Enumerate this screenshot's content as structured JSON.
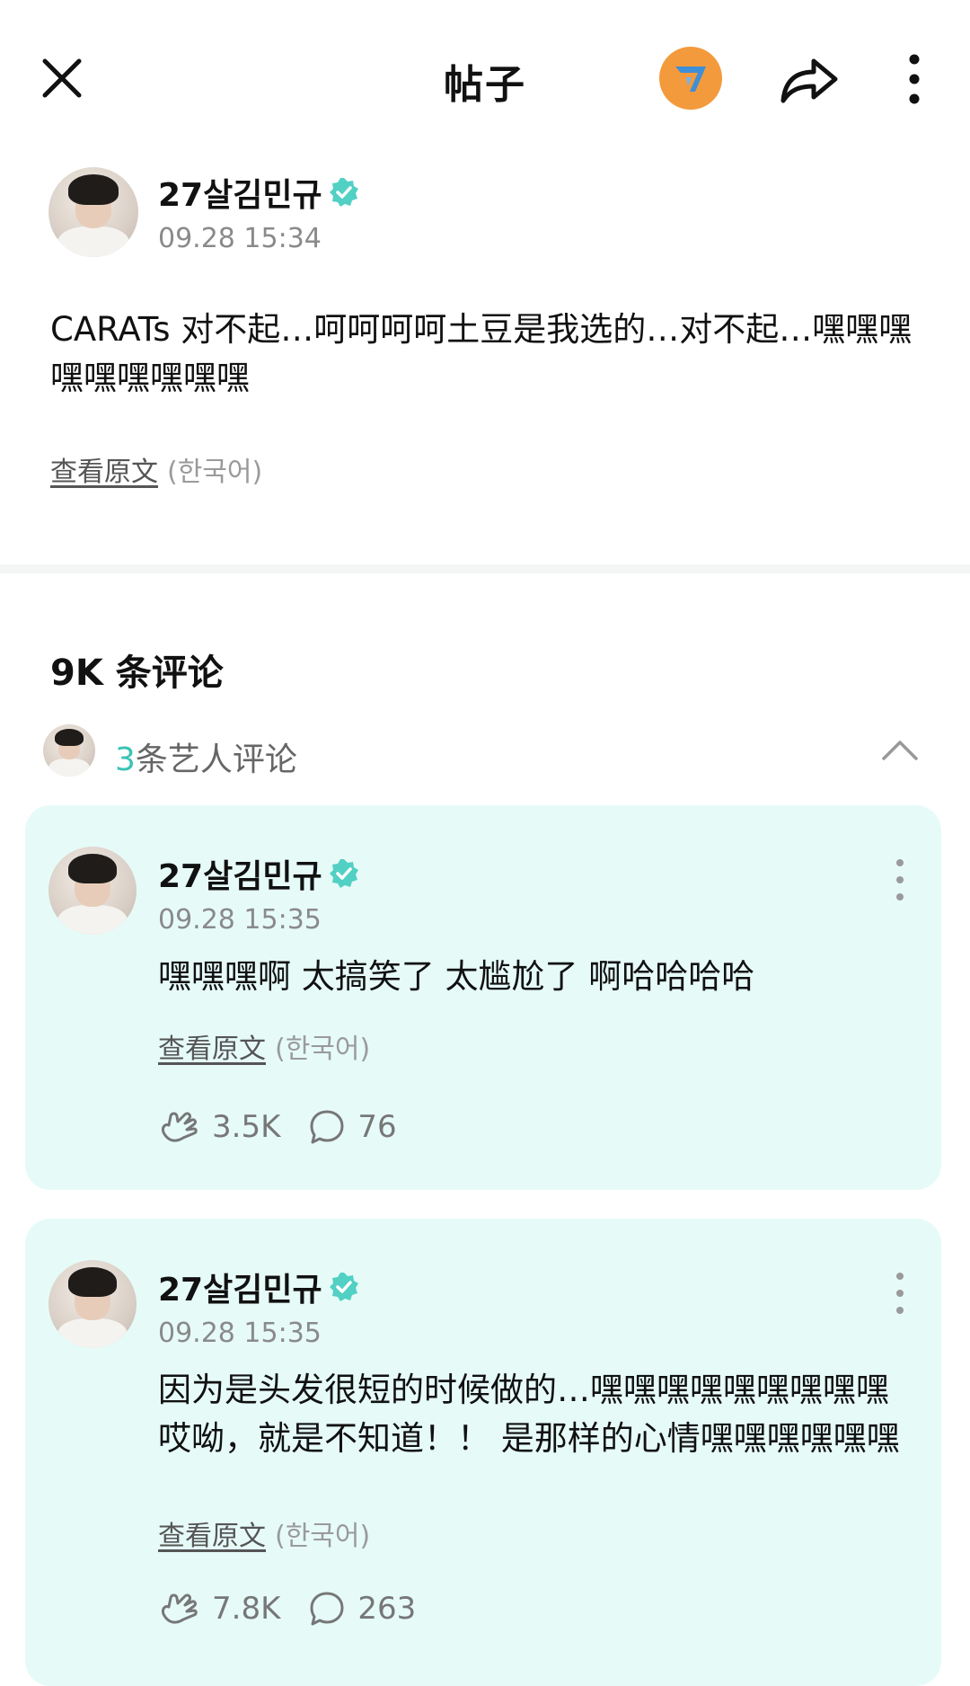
{
  "header": {
    "title": "帖子",
    "close_icon": "close-icon",
    "community_icon": "seventeen-logo-icon",
    "share_icon": "share-icon",
    "more_icon": "more-vertical-icon",
    "badge_color": "#f39a3c"
  },
  "post": {
    "author": "27살김민규",
    "time": "09.28 15:34",
    "text": "CARATs 对不起…呵呵呵呵土豆是我选的…对不起…嘿嘿嘿嘿嘿嘿嘿嘿嘿",
    "view_original": "查看原文",
    "original_lang": "(한국어)"
  },
  "comments_section": {
    "count_label": "9K 条评论",
    "artist_count": "3",
    "artist_label": "条艺人评论",
    "accent": "#3ac3b5",
    "card_bg": "#e6fbf8"
  },
  "comments": [
    {
      "author": "27살김민규",
      "time": "09.28 15:35",
      "text": "嘿嘿嘿啊 太搞笑了 太尴尬了 啊哈哈哈哈",
      "view_original": "查看原文",
      "original_lang": "(한국어)",
      "likes": "3.5K",
      "replies": "76"
    },
    {
      "author": "27살김민규",
      "time": "09.28 15:35",
      "text": "因为是头发很短的时候做的…嘿嘿嘿嘿嘿嘿嘿嘿嘿哎呦，就是不知道！！ 是那样的心情嘿嘿嘿嘿嘿嘿",
      "view_original": "查看原文",
      "original_lang": "(한국어)",
      "likes": "7.8K",
      "replies": "263"
    }
  ]
}
